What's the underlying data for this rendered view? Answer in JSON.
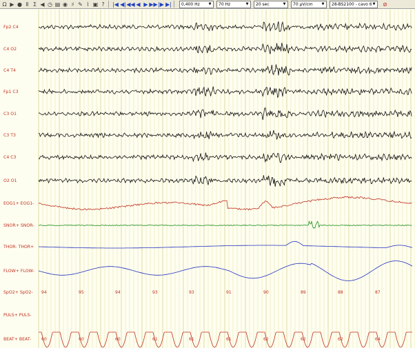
{
  "toolbar": {
    "icons": [
      "omega-icon",
      "play-icon",
      "record-icon",
      "pause-icon",
      "sum-icon",
      "back-icon",
      "clock-icon",
      "montage-icon",
      "eye-icon",
      "filter-icon",
      "settings-icon",
      "chart-icon",
      "export-icon",
      "help-icon"
    ],
    "nav_icons": [
      "first-page-icon",
      "prev-epoch-icon",
      "rewind-icon",
      "step-back-icon",
      "step-forward-icon",
      "fast-forward-icon",
      "next-epoch-icon",
      "last-page-icon"
    ],
    "combos": [
      {
        "name": "high-pass-select",
        "value": "0,400 Hz"
      },
      {
        "name": "low-pass-select",
        "value": "70 Hz"
      },
      {
        "name": "timebase-select",
        "value": "20 sec"
      },
      {
        "name": "sensitivity-select",
        "value": "70 µV/cm"
      },
      {
        "name": "montage-select",
        "value": "28-BS2100 - cavo 6"
      }
    ]
  },
  "channels": [
    {
      "label": "Fp2  C4",
      "type": "eeg",
      "color": "#101010"
    },
    {
      "label": "C4  O2",
      "type": "eeg",
      "color": "#101010"
    },
    {
      "label": "C4  T4",
      "type": "eeg",
      "color": "#101010"
    },
    {
      "label": "Fp1  C3",
      "type": "eeg",
      "color": "#101010"
    },
    {
      "label": "C3  O1",
      "type": "eeg",
      "color": "#101010"
    },
    {
      "label": "C3  T3",
      "type": "eeg",
      "color": "#101010"
    },
    {
      "label": "C4  C3",
      "type": "eeg",
      "color": "#101010"
    },
    {
      "label": "O2  O1",
      "type": "eeg",
      "color": "#101010"
    },
    {
      "label": "EOG1+ EOG1-",
      "type": "eog",
      "color": "#c03020"
    },
    {
      "label": "SNOR+ SNOR-",
      "type": "snore",
      "color": "#209020"
    },
    {
      "label": "THOR- THOR+",
      "type": "thor",
      "color": "#2030c0"
    },
    {
      "label": "FLOW+ FLOW-",
      "type": "flow",
      "color": "#2030c0"
    },
    {
      "label": "SpO2+ SpO2-",
      "type": "spo2",
      "color": "#c03020"
    },
    {
      "label": "PULS+ PULS-",
      "type": "puls",
      "color": "#c03020"
    },
    {
      "label": "BEAT+ BEAT-",
      "type": "beat",
      "color": "#c03020"
    }
  ],
  "spo2_values": [
    "94",
    "95",
    "94",
    "93",
    "93",
    "91",
    "90",
    "89",
    "88",
    "87"
  ],
  "beat_values": [
    "60",
    "60",
    "60",
    "61",
    "61",
    "61",
    "62",
    "62",
    "62",
    "64"
  ],
  "colors": {
    "background": "#fefef0",
    "grid": "#e6e0a8",
    "eeg": "#101010",
    "red": "#c03020",
    "blue": "#2030c0",
    "green": "#209020"
  }
}
